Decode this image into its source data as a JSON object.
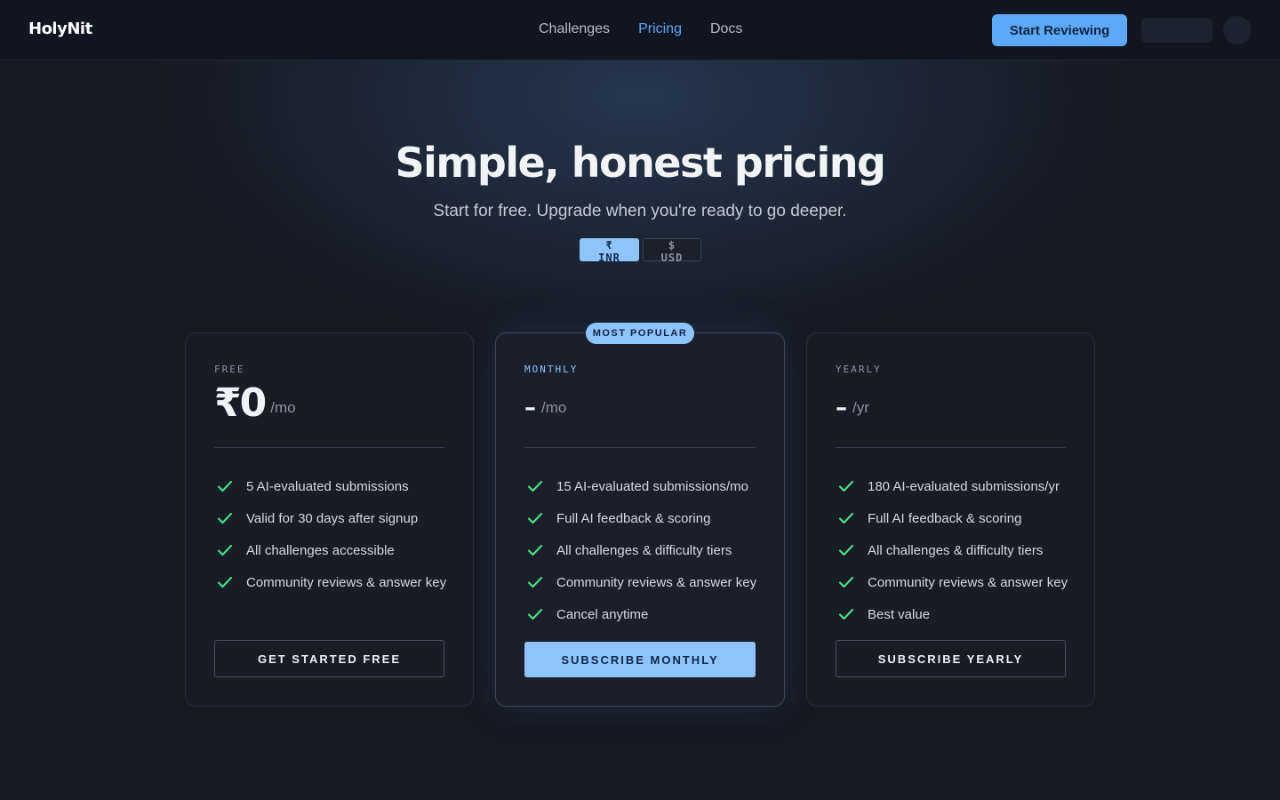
{
  "nav": {
    "logo": "HolyNit",
    "links": [
      {
        "label": "Challenges",
        "active": false
      },
      {
        "label": "Pricing",
        "active": true
      },
      {
        "label": "Docs",
        "active": false
      }
    ],
    "cta_label": "Start Reviewing"
  },
  "hero": {
    "title": "Simple, honest pricing",
    "subtitle": "Start for free. Upgrade when you're ready to go deeper.",
    "currency": {
      "inr_label": "₹ INR",
      "usd_label": "$ USD",
      "selected": "INR"
    }
  },
  "plans": [
    {
      "tier": "FREE",
      "price": "₹0",
      "period": "/mo",
      "features": [
        "5 AI-evaluated submissions",
        "Valid for 30 days after signup",
        "All challenges accessible",
        "Community reviews & answer key"
      ],
      "cta": "GET STARTED FREE"
    },
    {
      "tier": "MONTHLY",
      "badge": "MOST POPULAR",
      "price": "–",
      "period": "/mo",
      "features": [
        "15 AI-evaluated submissions/mo",
        "Full AI feedback & scoring",
        "All challenges & difficulty tiers",
        "Community reviews & answer key",
        "Cancel anytime"
      ],
      "cta": "SUBSCRIBE MONTHLY"
    },
    {
      "tier": "YEARLY",
      "price": "–",
      "period": "/yr",
      "features": [
        "180 AI-evaluated submissions/yr",
        "Full AI feedback & scoring",
        "All challenges & difficulty tiers",
        "Community reviews & answer key",
        "Best value"
      ],
      "cta": "SUBSCRIBE YEARLY"
    }
  ],
  "colors": {
    "background": "#141923",
    "accent": "#8ec3fb",
    "nav_accent": "#5ea9f7",
    "check": "#4ade80"
  }
}
